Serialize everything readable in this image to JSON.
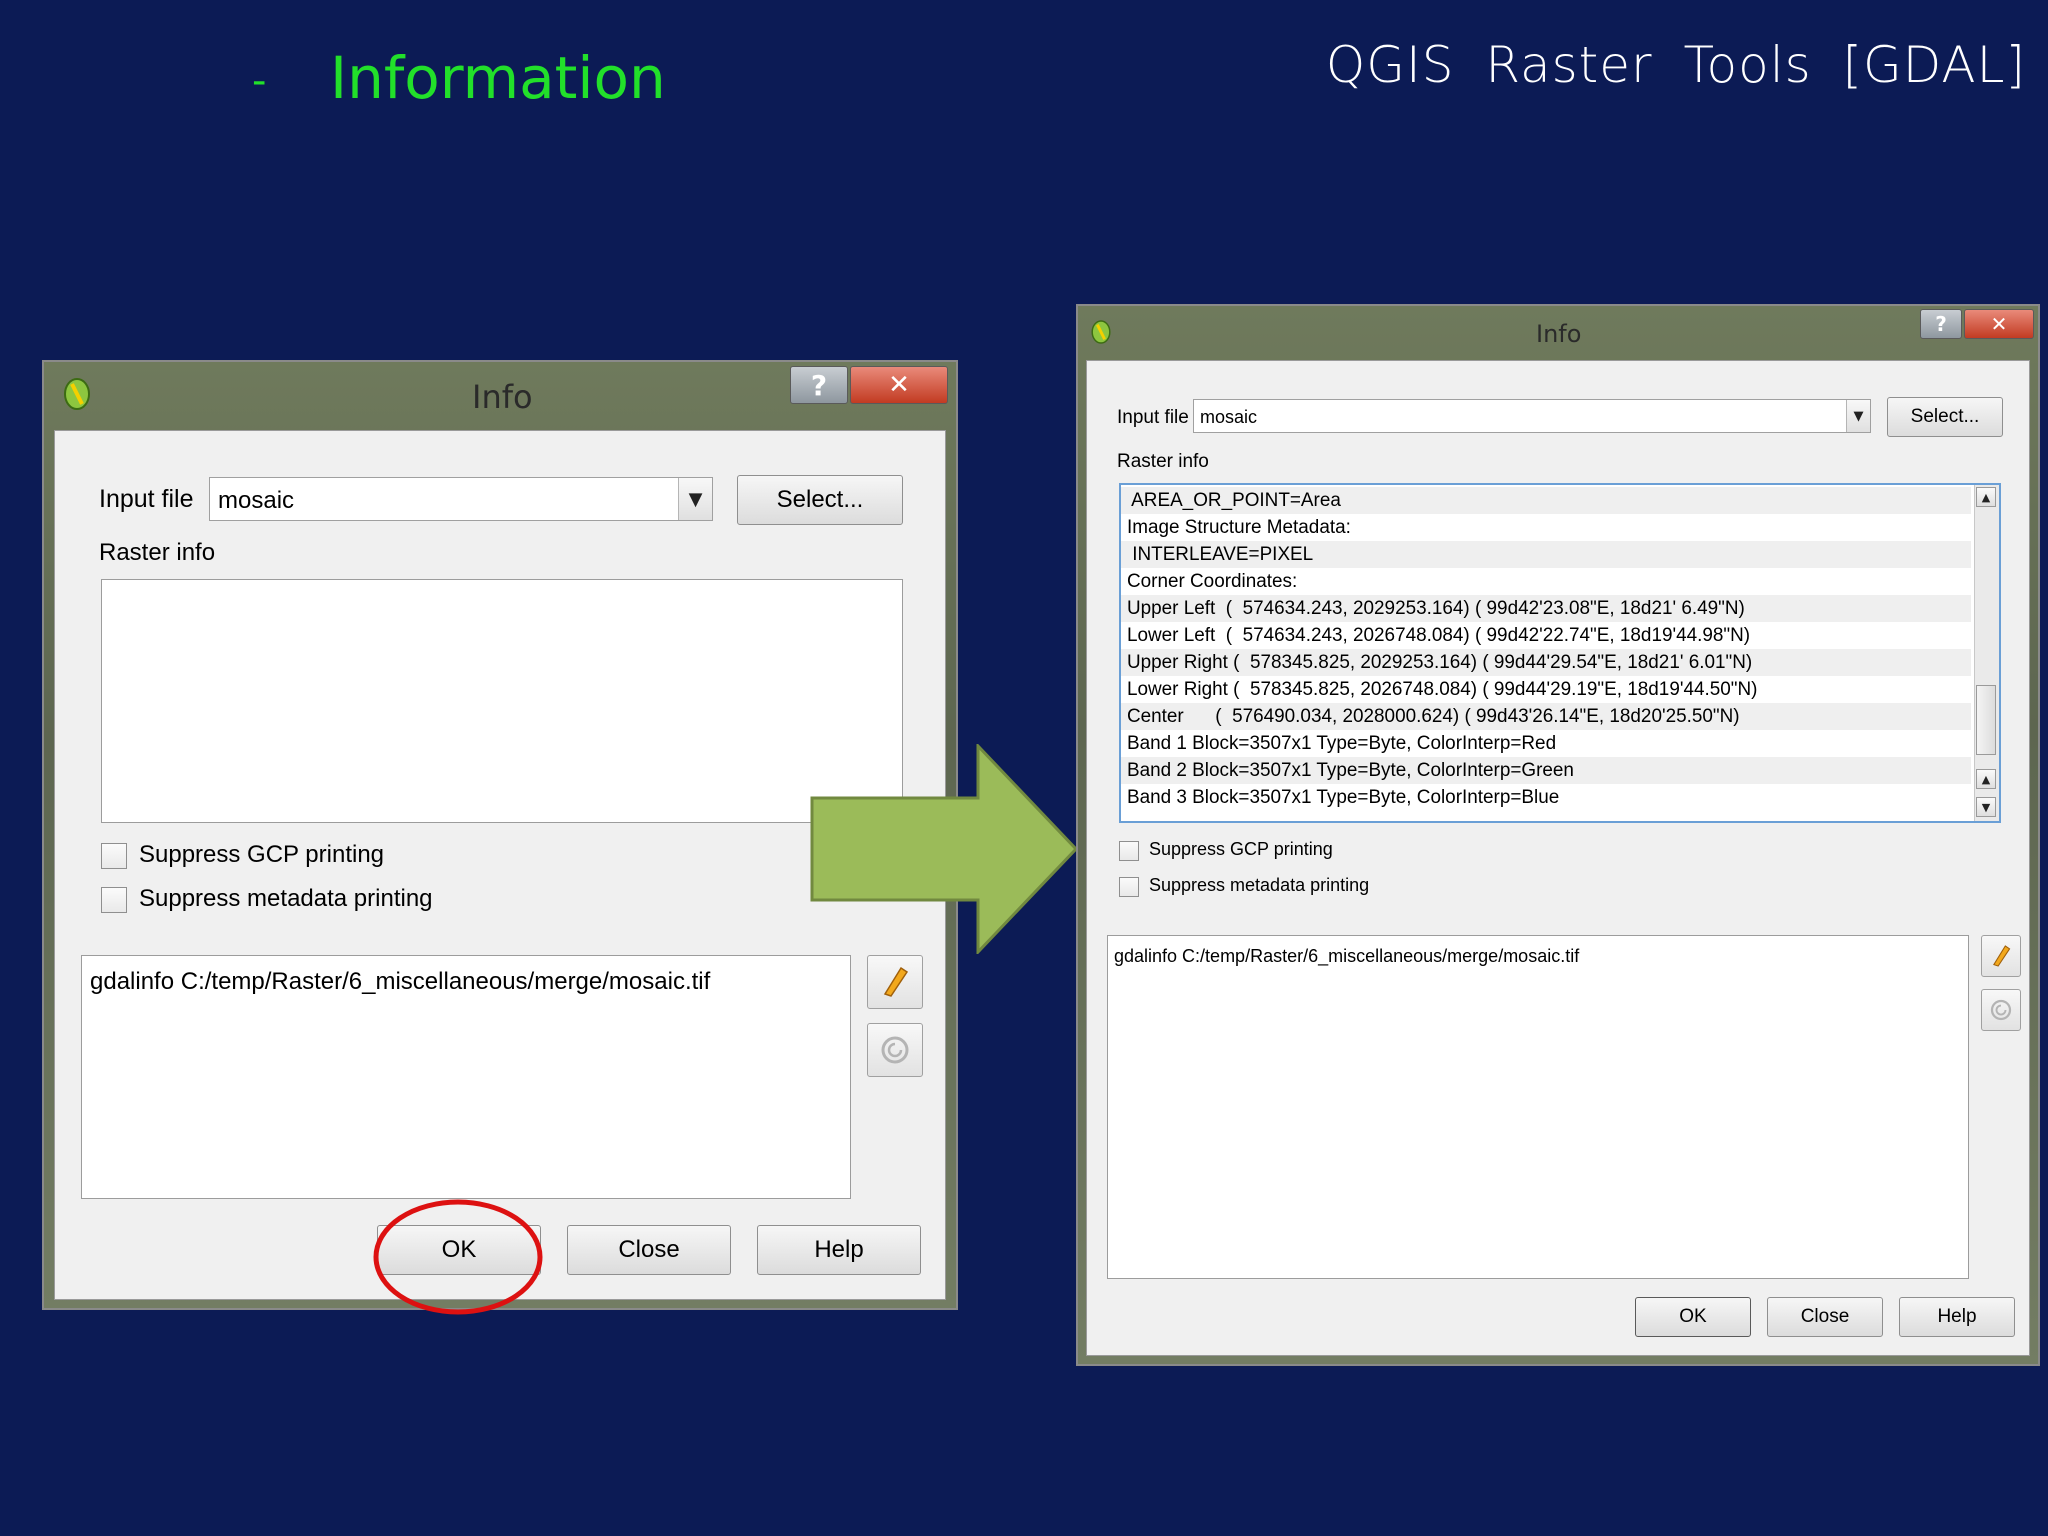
{
  "slide": {
    "dash": "-",
    "title": "Information",
    "topic": "QGIS Raster Tools [GDAL]"
  },
  "colors": {
    "background": "#0c1b55",
    "title_green": "#22e02a",
    "arrow_green": "#9bbb59",
    "highlight_red": "#dd1111"
  },
  "left_dialog": {
    "title": "Info",
    "help_glyph": "?",
    "close_glyph": "✕",
    "input_file_label": "Input file",
    "input_file_value": "mosaic",
    "select_button": "Select...",
    "raster_info_label": "Raster info",
    "suppress_gcp": "Suppress GCP printing",
    "suppress_metadata": "Suppress metadata printing",
    "command": "gdalinfo C:/temp/Raster/6_miscellaneous/merge/mosaic.tif",
    "ok_button": "OK",
    "close_button": "Close",
    "help_button": "Help"
  },
  "right_dialog": {
    "title": "Info",
    "help_glyph": "?",
    "close_glyph": "✕",
    "input_file_label": "Input file",
    "input_file_value": "mosaic",
    "select_button": "Select...",
    "raster_info_label": "Raster info",
    "raster_info_lines": [
      " AREA_OR_POINT=Area",
      "Image Structure Metadata:",
      " INTERLEAVE=PIXEL",
      "Corner Coordinates:",
      "Upper Left  (  574634.243, 2029253.164) ( 99d42'23.08\"E, 18d21' 6.49\"N)",
      "Lower Left  (  574634.243, 2026748.084) ( 99d42'22.74\"E, 18d19'44.98\"N)",
      "Upper Right (  578345.825, 2029253.164) ( 99d44'29.54\"E, 18d21' 6.01\"N)",
      "Lower Right (  578345.825, 2026748.084) ( 99d44'29.19\"E, 18d19'44.50\"N)",
      "Center      (  576490.034, 2028000.624) ( 99d43'26.14\"E, 18d20'25.50\"N)",
      "Band 1 Block=3507x1 Type=Byte, ColorInterp=Red",
      "Band 2 Block=3507x1 Type=Byte, ColorInterp=Green",
      "Band 3 Block=3507x1 Type=Byte, ColorInterp=Blue"
    ],
    "suppress_gcp": "Suppress GCP printing",
    "suppress_metadata": "Suppress metadata printing",
    "command": "gdalinfo C:/temp/Raster/6_miscellaneous/merge/mosaic.tif",
    "ok_button": "OK",
    "close_button": "Close",
    "help_button": "Help"
  }
}
